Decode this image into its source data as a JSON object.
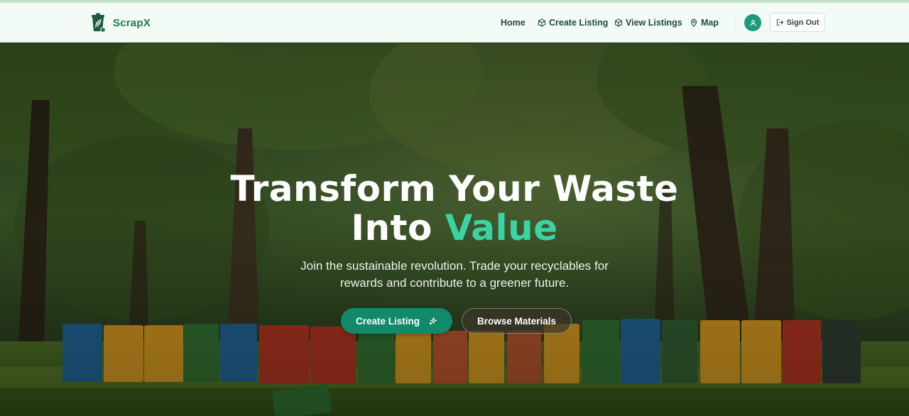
{
  "brand": {
    "name": "ScrapX"
  },
  "nav": {
    "home": "Home",
    "create_listing": "Create Listing",
    "view_listings": "View Listings",
    "map": "Map",
    "sign_out": "Sign Out"
  },
  "hero": {
    "title_line1": "Transform Your Waste",
    "title_line2_plain": "Into",
    "title_line2_accent": "Value",
    "subtitle_line1": "Join the sustainable revolution. Trade your recyclables for",
    "subtitle_line2": "rewards and contribute to a greener future.",
    "primary_cta": "Create Listing",
    "secondary_cta": "Browse Materials"
  },
  "colors": {
    "brand": "#1f7a53",
    "accent": "#3ad4a4",
    "primary_button": "#128a6a",
    "navbar_bg": "#f2fbf6"
  },
  "icons": {
    "logo": "recycle-bin-leaf-icon",
    "create_listing": "package-icon",
    "view_listings": "package-icon",
    "map": "map-pin-icon",
    "avatar": "user-icon",
    "sign_out": "logout-icon",
    "cta_sparkle": "sparkles-icon"
  }
}
